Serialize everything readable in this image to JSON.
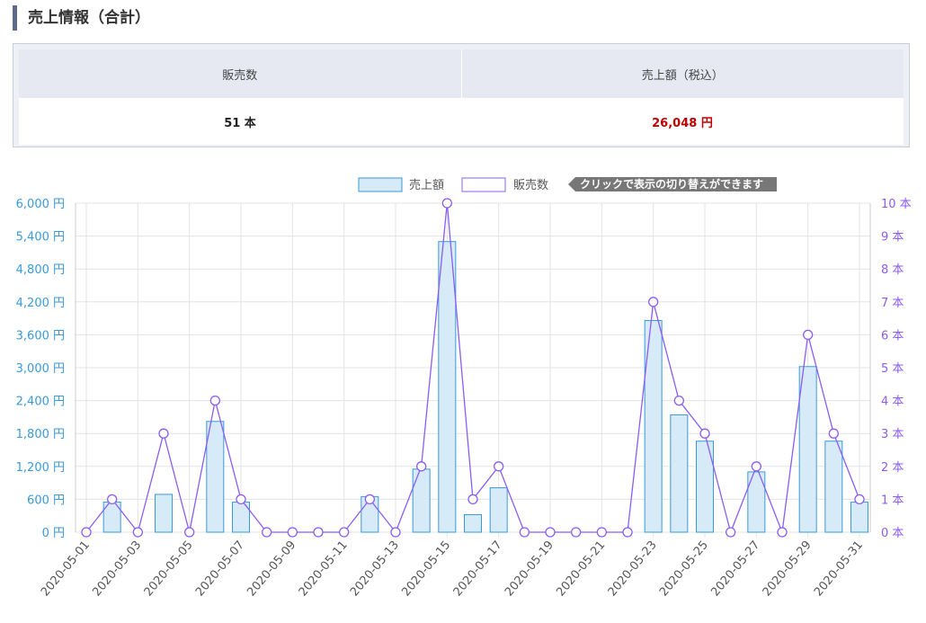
{
  "page": {
    "section_title": "売上情報（合計）"
  },
  "summary": {
    "headers": [
      "販売数",
      "売上額（税込）"
    ],
    "values": [
      "51 本",
      "26,048 円"
    ]
  },
  "legend": {
    "items": [
      {
        "label": "売上額"
      },
      {
        "label": "販売数"
      }
    ],
    "hint": "クリックで表示の切り替えができます"
  },
  "colors": {
    "bar_fill": "#d6eaf8",
    "bar_stroke": "#3a9ad9",
    "line": "#8b5cf6",
    "left_axis": "#3a9ad9",
    "right_axis": "#8b5cf6",
    "red_value": "#c00000",
    "hint_bg": "#777777"
  },
  "chart_data": {
    "type": "bar",
    "x": [
      "2020-05-01",
      "2020-05-02",
      "2020-05-03",
      "2020-05-04",
      "2020-05-05",
      "2020-05-06",
      "2020-05-07",
      "2020-05-08",
      "2020-05-09",
      "2020-05-10",
      "2020-05-11",
      "2020-05-12",
      "2020-05-13",
      "2020-05-14",
      "2020-05-15",
      "2020-05-16",
      "2020-05-17",
      "2020-05-18",
      "2020-05-19",
      "2020-05-20",
      "2020-05-21",
      "2020-05-22",
      "2020-05-23",
      "2020-05-24",
      "2020-05-25",
      "2020-05-26",
      "2020-05-27",
      "2020-05-28",
      "2020-05-29",
      "2020-05-30",
      "2020-05-31"
    ],
    "x_tick_labels": [
      "2020-05-01",
      "2020-05-03",
      "2020-05-05",
      "2020-05-07",
      "2020-05-09",
      "2020-05-11",
      "2020-05-13",
      "2020-05-15",
      "2020-05-17",
      "2020-05-19",
      "2020-05-21",
      "2020-05-23",
      "2020-05-25",
      "2020-05-27",
      "2020-05-29",
      "2020-05-31"
    ],
    "series": [
      {
        "name": "売上額",
        "type": "bar",
        "axis": "left",
        "values": [
          0,
          550,
          0,
          690,
          0,
          2020,
          550,
          0,
          0,
          0,
          0,
          650,
          0,
          1150,
          5300,
          320,
          810,
          0,
          0,
          0,
          0,
          0,
          3860,
          2140,
          1660,
          0,
          1100,
          0,
          3020,
          1660,
          550
        ]
      },
      {
        "name": "販売数",
        "type": "line",
        "axis": "right",
        "values": [
          0,
          1,
          0,
          3,
          0,
          4,
          1,
          0,
          0,
          0,
          0,
          1,
          0,
          2,
          10,
          1,
          2,
          0,
          0,
          0,
          0,
          0,
          7,
          4,
          3,
          0,
          2,
          0,
          6,
          3,
          1
        ]
      }
    ],
    "left_axis": {
      "ylim": [
        0,
        6000
      ],
      "tick_labels": [
        "0 円",
        "600 円",
        "1,200 円",
        "1,800 円",
        "2,400 円",
        "3,000 円",
        "3,600 円",
        "4,200 円",
        "4,800 円",
        "5,400 円",
        "6,000 円"
      ]
    },
    "right_axis": {
      "ylim": [
        0,
        10
      ],
      "tick_labels": [
        "0 本",
        "1 本",
        "2 本",
        "3 本",
        "4 本",
        "5 本",
        "6 本",
        "7 本",
        "8 本",
        "9 本",
        "10 本"
      ]
    },
    "grid": true,
    "legend": "top-center"
  }
}
